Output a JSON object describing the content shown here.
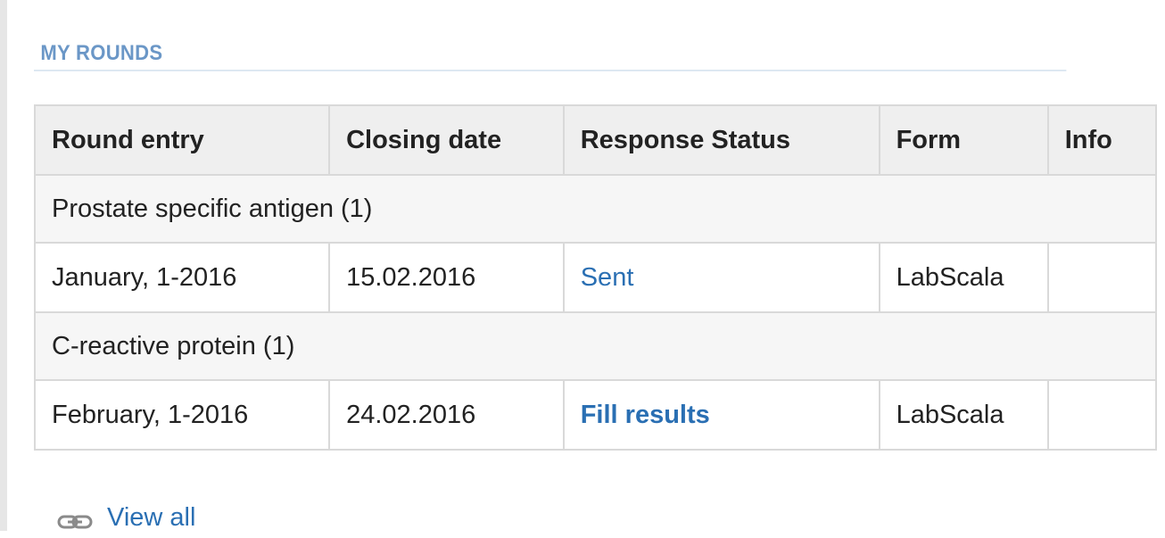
{
  "section": {
    "title": "MY ROUNDS"
  },
  "table": {
    "headers": [
      "Round entry",
      "Closing date",
      "Response Status",
      "Form",
      "Info"
    ],
    "groups": [
      {
        "label": "Prostate specific antigen (1)",
        "rows": [
          {
            "round_entry": "January, 1-2016",
            "closing_date": "15.02.2016",
            "status": "Sent",
            "form": "LabScala",
            "info": ""
          }
        ]
      },
      {
        "label": "C-reactive protein (1)",
        "rows": [
          {
            "round_entry": "February, 1-2016",
            "closing_date": "24.02.2016",
            "status": "Fill results",
            "form": "LabScala",
            "info": ""
          }
        ]
      }
    ]
  },
  "footer": {
    "view_all_label": "View all",
    "icon": "link-icon"
  },
  "colors": {
    "title": "#6b97c7",
    "link": "#2a6fb3",
    "header_bg": "#efefef",
    "border": "#d9d9d9"
  }
}
